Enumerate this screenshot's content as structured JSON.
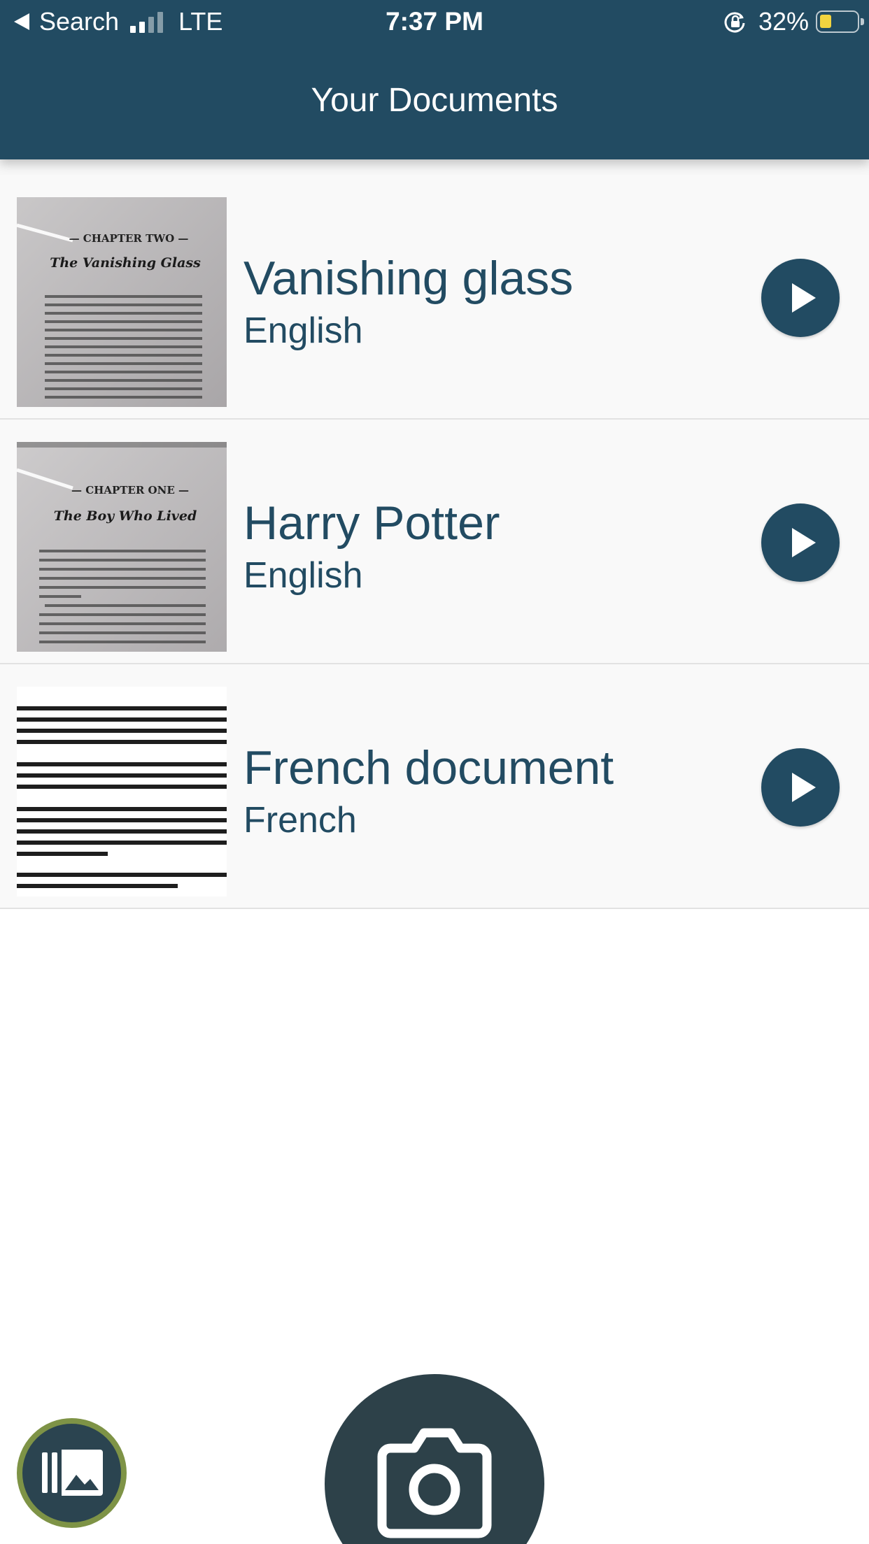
{
  "status_bar": {
    "back_label": "Search",
    "network": "LTE",
    "time": "7:37 PM",
    "battery": "32%",
    "battery_level": 0.32,
    "signal_bars": 2
  },
  "header": {
    "title": "Your Documents"
  },
  "documents": [
    {
      "title": "Vanishing glass",
      "language": "English",
      "thumb_heading": "— CHAPTER TWO —",
      "thumb_subheading": "The Vanishing Glass",
      "thumb_icon": "book-page-thumbnail"
    },
    {
      "title": "Harry Potter",
      "language": "English",
      "thumb_heading": "— CHAPTER ONE —",
      "thumb_subheading": "The Boy Who Lived",
      "thumb_icon": "book-page-thumbnail"
    },
    {
      "title": "French document",
      "language": "French",
      "thumb_heading": "",
      "thumb_subheading": "",
      "thumb_icon": "text-page-thumbnail"
    }
  ],
  "icons": {
    "play": "play-icon",
    "gallery": "photo-library-icon",
    "camera": "camera-icon"
  },
  "colors": {
    "header_bg": "#224b62",
    "accent": "#224b62",
    "gallery_ring": "#7e9346",
    "camera_bg": "#2d4149"
  }
}
